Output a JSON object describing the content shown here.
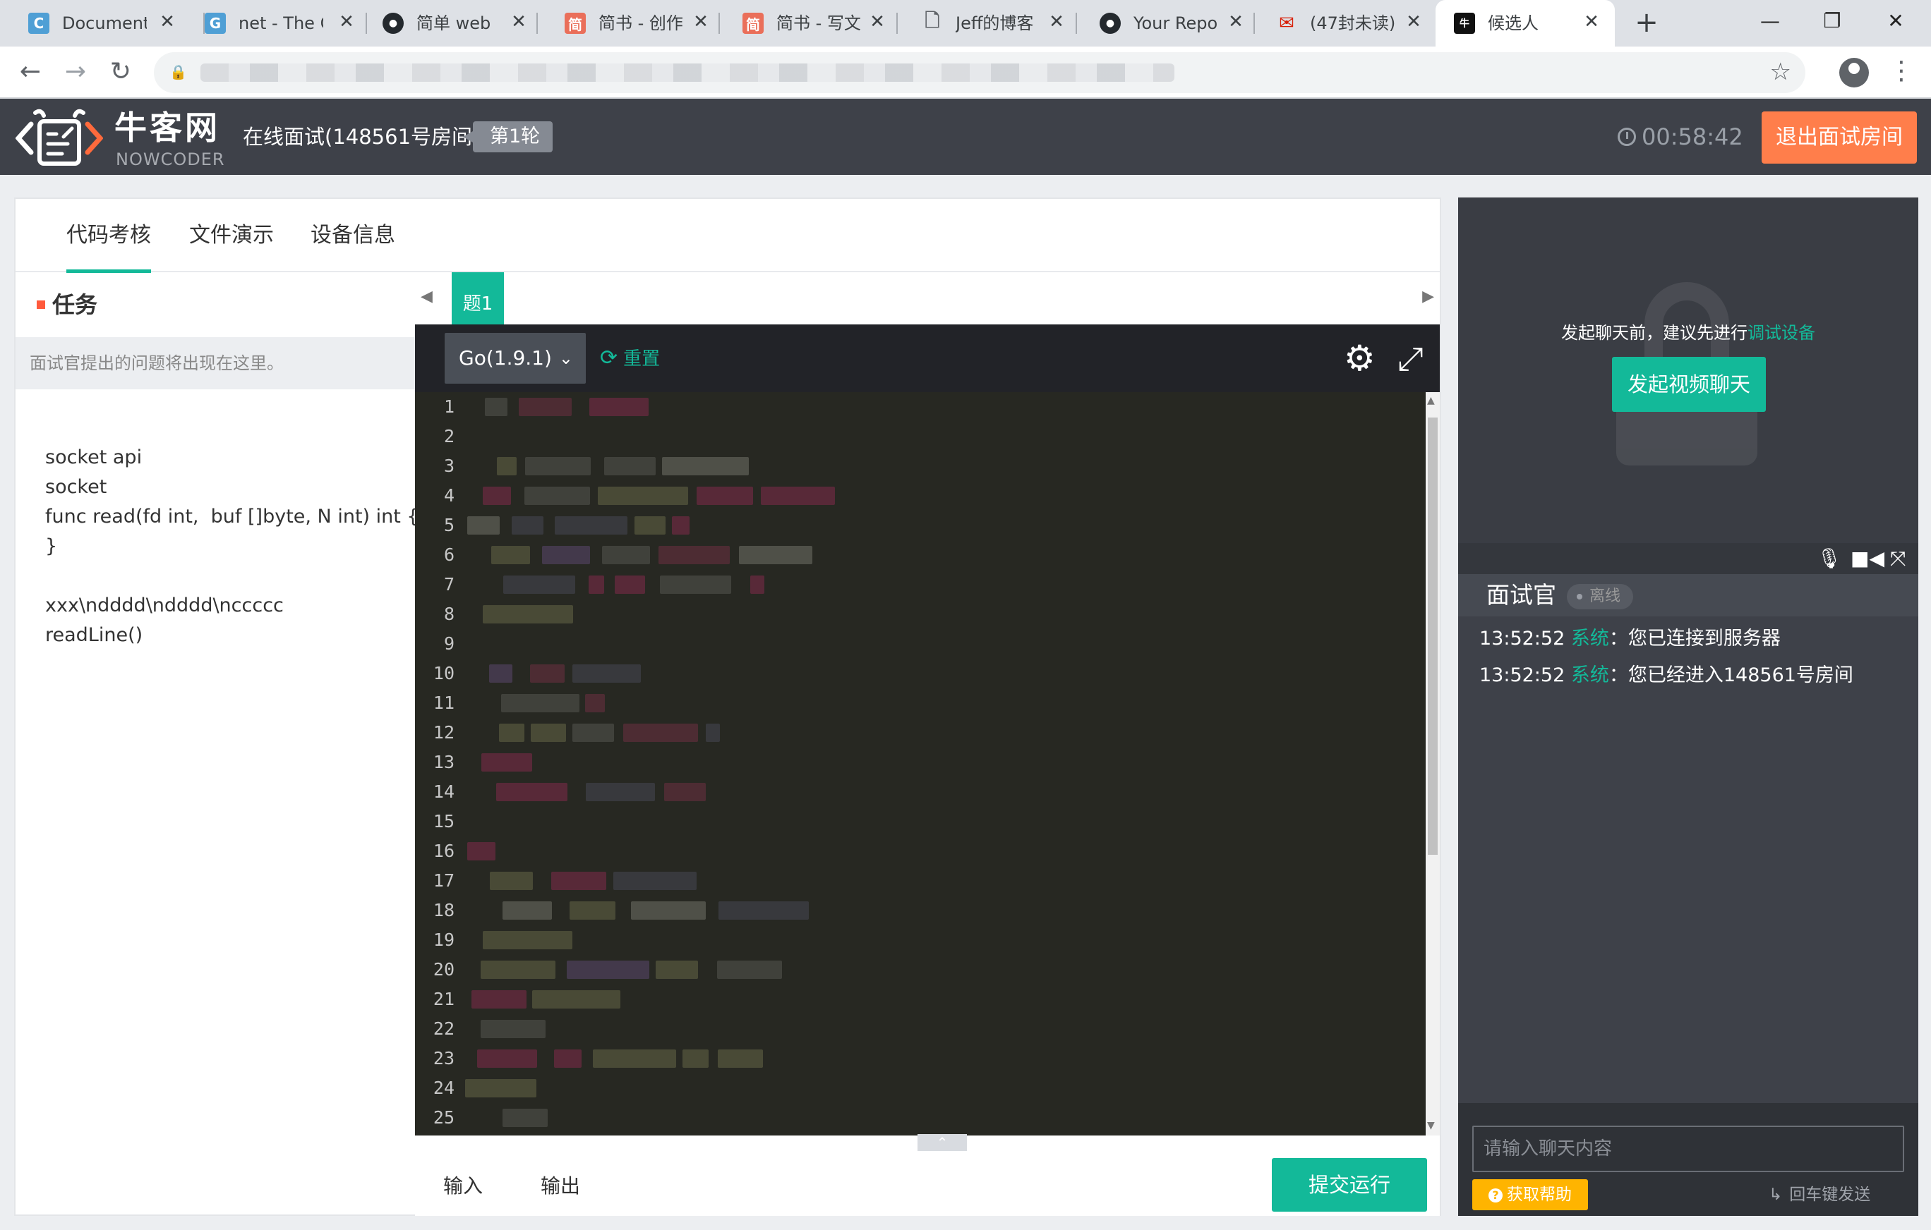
{
  "browser": {
    "tabs": [
      {
        "title": "Document",
        "favicon": "C",
        "favicon_color": "#4f9fd5"
      },
      {
        "title": "net - The G",
        "favicon": "G",
        "favicon_color": "#4f9fd5"
      },
      {
        "title": "简单 web",
        "favicon": "github-icon",
        "favicon_color": "#24292e"
      },
      {
        "title": "简书 - 创作",
        "favicon": "简",
        "favicon_color": "#ea6f5a"
      },
      {
        "title": "简书 - 写文",
        "favicon": "简",
        "favicon_color": "#ea6f5a"
      },
      {
        "title": "Jeff的博客",
        "favicon": "page-icon",
        "favicon_color": "#5f6368"
      },
      {
        "title": "Your Repo",
        "favicon": "github-icon",
        "favicon_color": "#24292e"
      },
      {
        "title": "(47封未读)",
        "favicon": "mail-icon",
        "favicon_color": "#d81e06"
      },
      {
        "title": "候选人",
        "favicon": "nowcoder-icon",
        "favicon_color": "#111111"
      }
    ],
    "icons": {
      "close": "✕",
      "new_tab": "+",
      "minimize": "—",
      "restore": "❐",
      "win_close": "✕",
      "back": "←",
      "forward": "→",
      "reload": "↻",
      "lock": "🔒",
      "star": "☆",
      "menu": "⋮"
    }
  },
  "header": {
    "logo_cn": "牛客网",
    "logo_en": "NOWCODER",
    "room_title": "在线面试(148561号房间)",
    "round_badge": "第1轮",
    "timer": "00:58:42",
    "exit_label": "退出面试房间"
  },
  "main": {
    "tabs": [
      "代码考核",
      "文件演示",
      "设备信息"
    ],
    "task_title": "任务",
    "task_hint": "面试官提出的问题将出现在这里。",
    "task_body": "socket api\nsocket\nfunc read(fd int,  buf []byte, N int) int {\n}\n\nxxx\\ndddd\\ndddd\\nccccc\nreadLine()"
  },
  "editor": {
    "problem_tab": "题1",
    "language": "Go(1.9.1)",
    "reset_label": "重置",
    "line_numbers": [
      "1",
      "2",
      "3",
      "4",
      "5",
      "6",
      "7",
      "8",
      "9",
      "10",
      "11",
      "12",
      "13",
      "14",
      "15",
      "16",
      "17",
      "18",
      "19",
      "20",
      "21",
      "22",
      "23",
      "24",
      "25"
    ],
    "io_tabs": [
      "输入",
      "输出"
    ],
    "submit_label": "提交运行"
  },
  "side": {
    "video_hint_prefix": "发起聊天前，建议先进行",
    "video_hint_link": "调试设备",
    "start_video_label": "发起视频聊天",
    "chat_title": "面试官",
    "status": "离线",
    "messages": [
      {
        "time": "13:52:52",
        "sender": "系统",
        "text": "：您已连接到服务器"
      },
      {
        "time": "13:52:52",
        "sender": "系统",
        "text": "：您已经进入148561号房间"
      }
    ],
    "chat_placeholder": "请输入聊天内容",
    "help_label": "获取帮助",
    "enter_hint": "回车键发送"
  },
  "colors": {
    "accent": "#13b999",
    "exit": "#ff7e4b",
    "help": "#ffb400",
    "header_bg": "#3e4149",
    "editor_bg": "#272822"
  }
}
